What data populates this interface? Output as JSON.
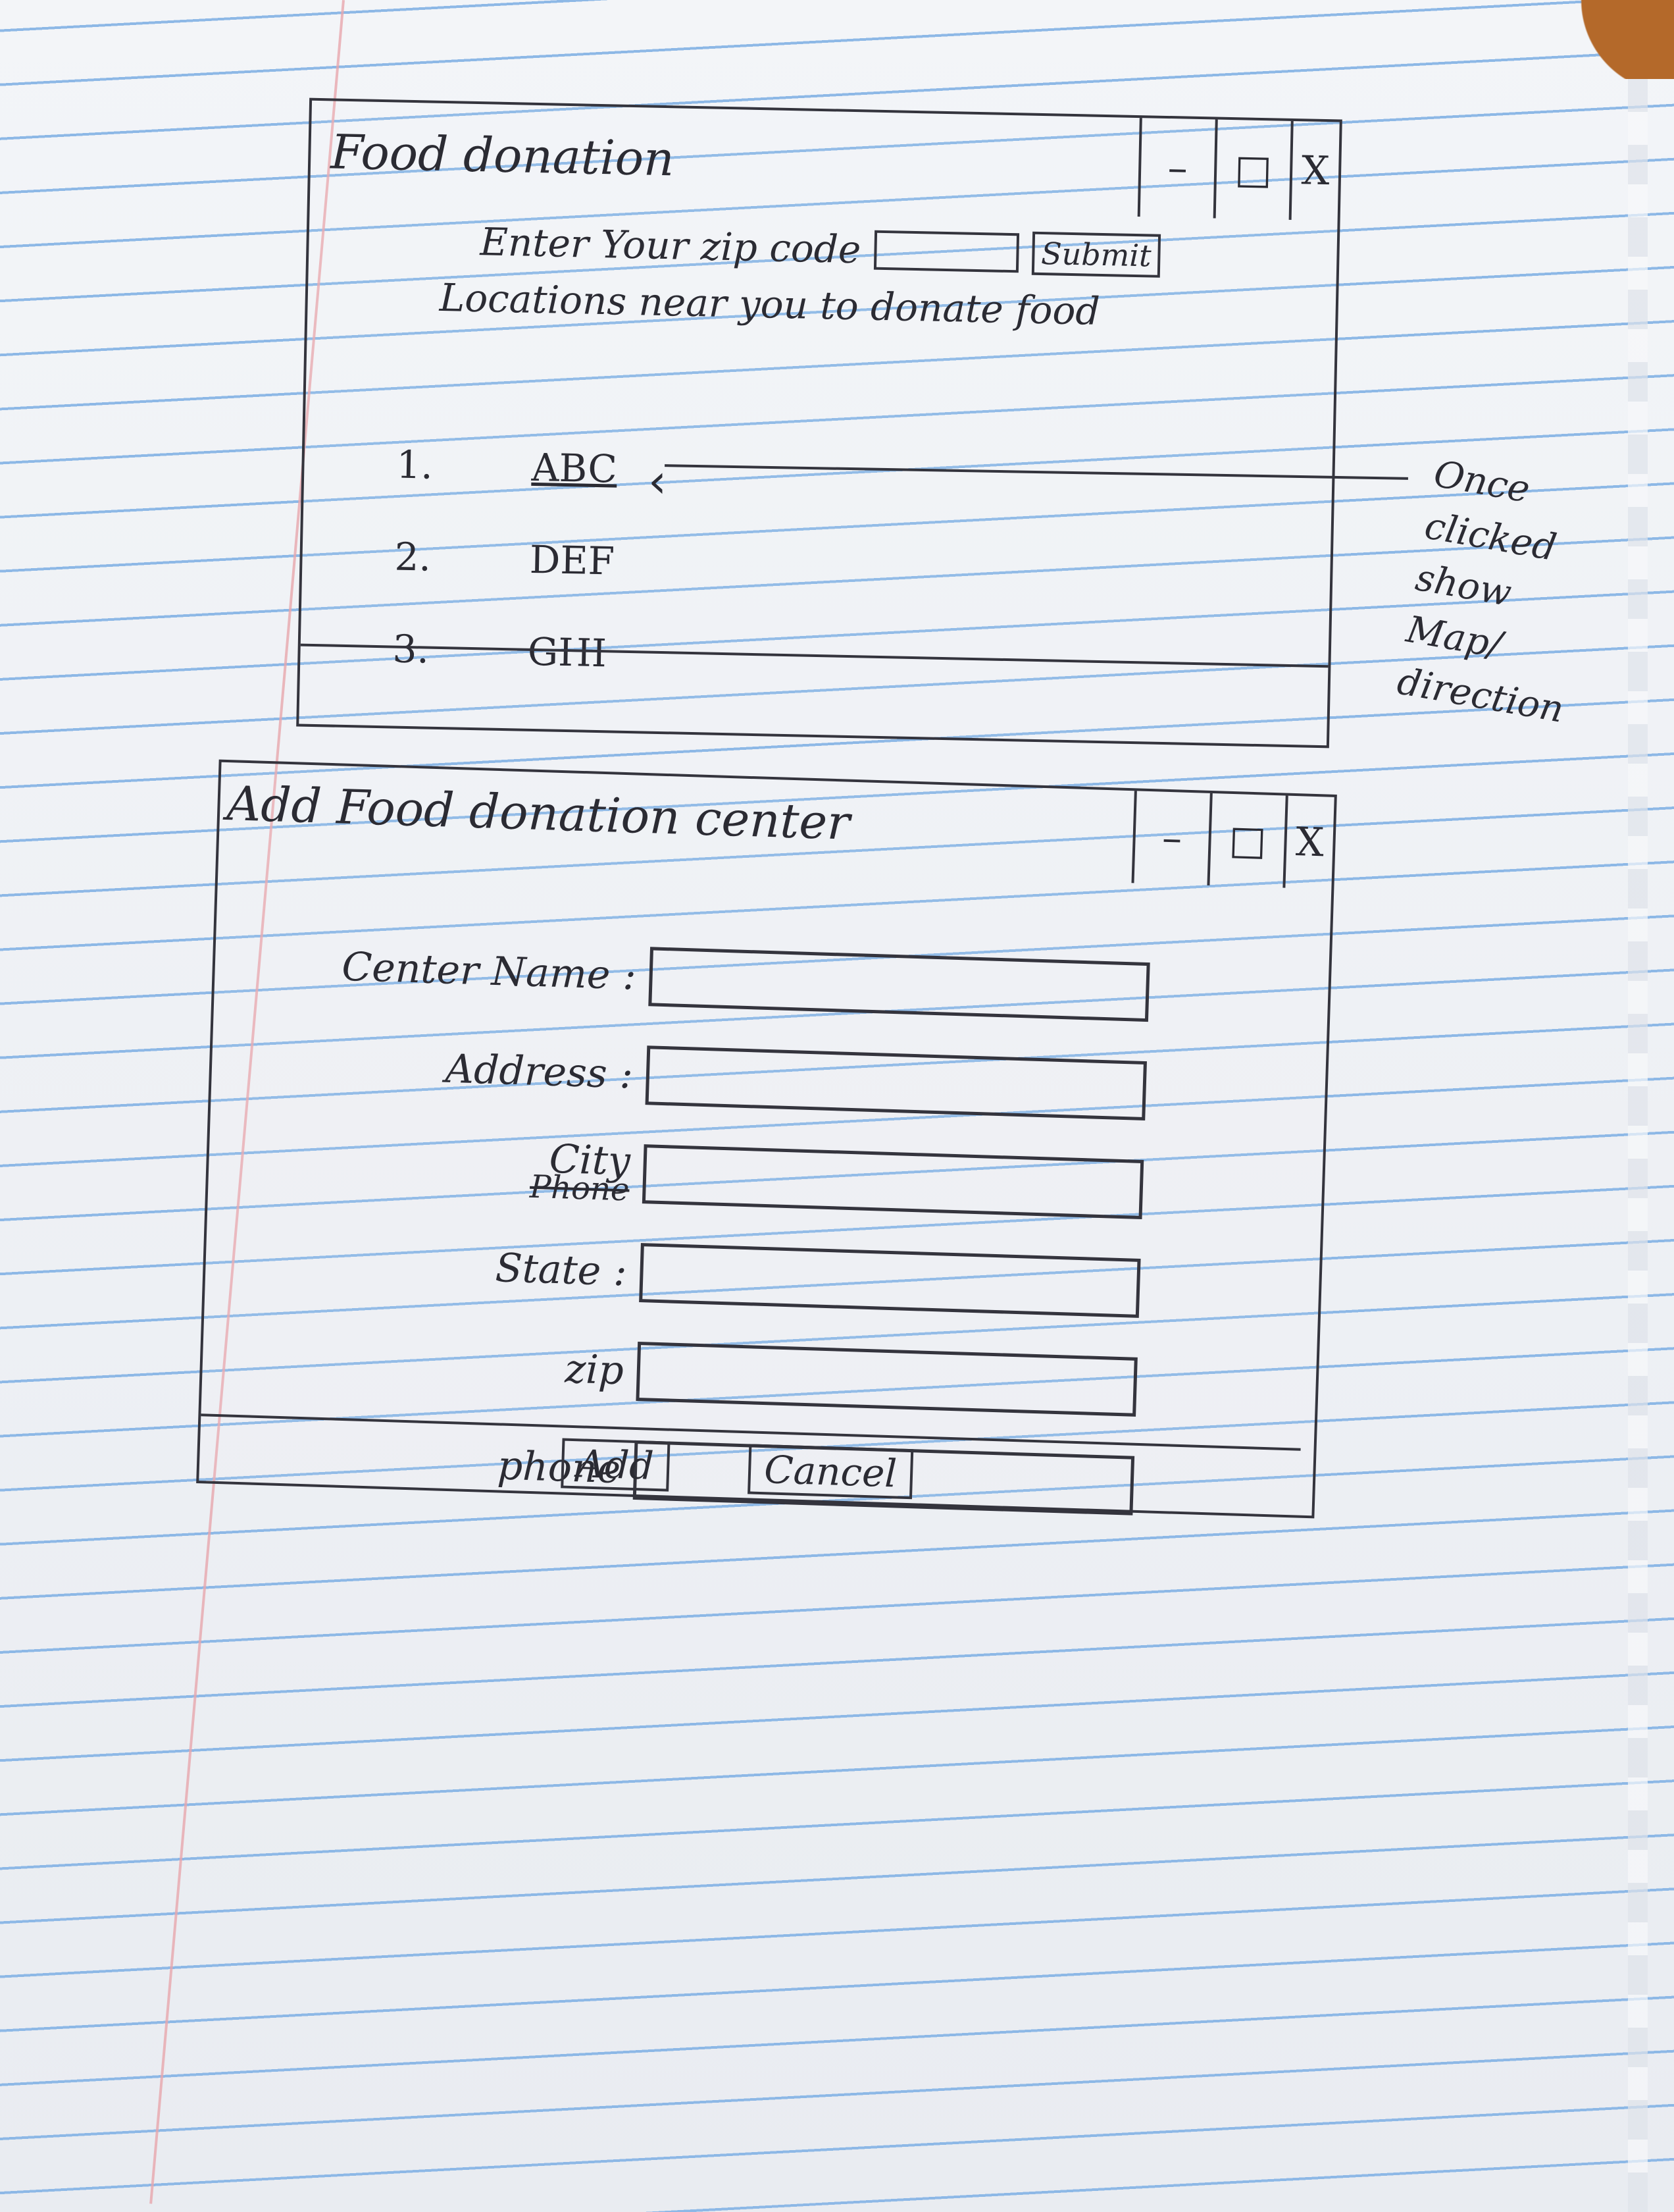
{
  "window1": {
    "title": "Food donation",
    "controls": {
      "minimize": "–",
      "maximize": "□",
      "close": "X"
    },
    "zip_label": "Enter Your zip code",
    "zip_value": "",
    "submit_label": "Submit",
    "locations_heading": "Locations near you to donate food",
    "locations": [
      {
        "num": "1.",
        "name": "ABC"
      },
      {
        "num": "2.",
        "name": "DEF"
      },
      {
        "num": "3.",
        "name": "GHI"
      }
    ]
  },
  "annotation": {
    "text": "Once clicked show Map/ direction"
  },
  "window2": {
    "title": "Add Food donation center",
    "controls": {
      "minimize": "–",
      "maximize": "□",
      "close": "X"
    },
    "fields": {
      "center_name": "Center Name :",
      "address": "Address :",
      "city": "City",
      "city_strikethrough": "Phone",
      "state": "State :",
      "zip": "zip",
      "phone": "phone"
    },
    "add_label": "Add",
    "cancel_label": "Cancel"
  }
}
